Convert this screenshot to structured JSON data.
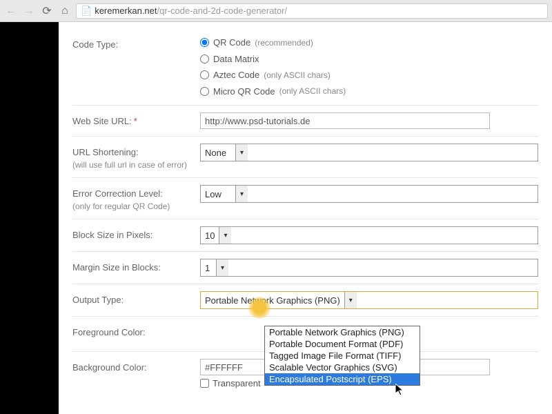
{
  "browser": {
    "url_host": "keremerkan.net",
    "url_path": "/qr-code-and-2d-code-generator/"
  },
  "form": {
    "code_type": {
      "label": "Code Type:",
      "options": [
        {
          "text": "QR Code",
          "suffix": "(recommended)",
          "checked": true
        },
        {
          "text": "Data Matrix",
          "suffix": "",
          "checked": false
        },
        {
          "text": "Aztec Code",
          "suffix": "(only ASCII chars)",
          "checked": false
        },
        {
          "text": "Micro QR Code",
          "suffix": "(only ASCII chars)",
          "checked": false
        }
      ]
    },
    "web_url": {
      "label": "Web Site URL:",
      "required": "*",
      "value": "http://www.psd-tutorials.de"
    },
    "url_shortening": {
      "label": "URL Shortening:",
      "sub": "(will use full url in case of error)",
      "value": "None"
    },
    "error_correction": {
      "label": "Error Correction Level:",
      "sub": "(only for regular QR Code)",
      "value": "Low"
    },
    "block_size": {
      "label": "Block Size in Pixels:",
      "value": "10"
    },
    "margin_size": {
      "label": "Margin Size in Blocks:",
      "value": "1"
    },
    "output_type": {
      "label": "Output Type:",
      "value": "Portable Network Graphics (PNG)",
      "options": [
        "Portable Network Graphics (PNG)",
        "Portable Document Format (PDF)",
        "Tagged Image File Format (TIFF)",
        "Scalable Vector Graphics (SVG)",
        "Encapsulated Postscript (EPS)"
      ],
      "highlighted": "Encapsulated Postscript (EPS)"
    },
    "fg_color": {
      "label": "Foreground Color:"
    },
    "bg_color": {
      "label": "Background Color:",
      "value": "#FFFFFF",
      "transparent_label": "Transparent"
    }
  }
}
